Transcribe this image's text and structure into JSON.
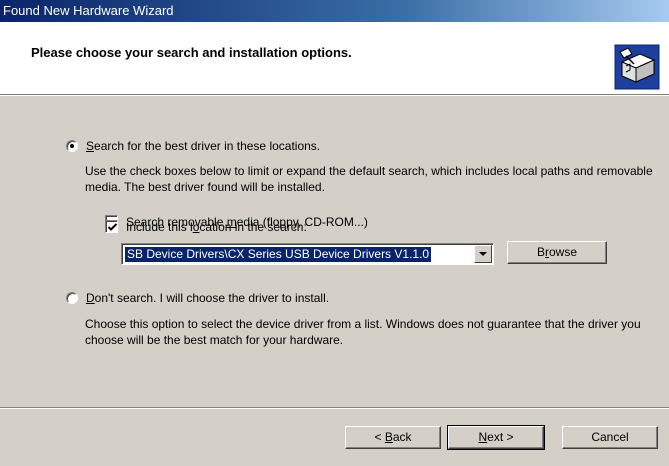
{
  "window": {
    "title": "Found New Hardware Wizard"
  },
  "header": {
    "title": "Please choose your search and installation options.",
    "icon": "hardware-wizard-icon"
  },
  "options": {
    "search": {
      "label_pre": "",
      "label_mnemonic": "S",
      "label_post": "earch for the best driver in these locations.",
      "selected": true,
      "description": "Use the check boxes below to limit or expand the default search, which includes local paths and removable media. The best driver found will be installed."
    },
    "removable": {
      "label_pre": "Search removable ",
      "label_mnemonic": "m",
      "label_post": "edia (floppy, CD-ROM...)",
      "checked": false
    },
    "location": {
      "label_pre": "Include this l",
      "label_mnemonic": "o",
      "label_post": "cation in the search:",
      "checked": true,
      "path_value": "SB Device Drivers\\CX Series USB Device Drivers V1.1.0"
    },
    "dont_search": {
      "label_pre": "",
      "label_mnemonic": "D",
      "label_post": "on't search. I will choose the driver to install.",
      "selected": false,
      "description": "Choose this option to select the device driver from a list.  Windows does not guarantee that the driver you choose will be the best match for your hardware."
    }
  },
  "buttons": {
    "browse": {
      "pre": "B",
      "mnemonic": "r",
      "post": "owse"
    },
    "back": {
      "pre": "< ",
      "mnemonic": "B",
      "post": "ack"
    },
    "next": {
      "pre": "",
      "mnemonic": "N",
      "post": "ext >"
    },
    "cancel": "Cancel"
  }
}
